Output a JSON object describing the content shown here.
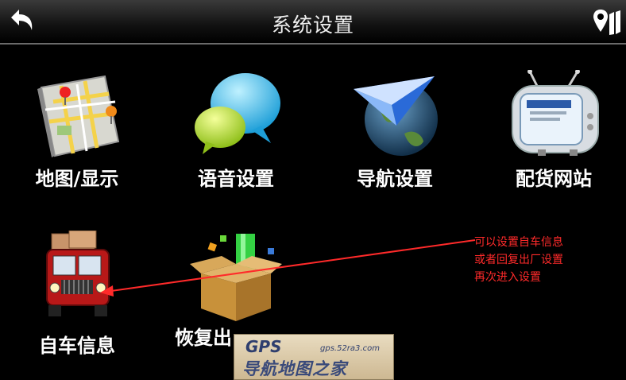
{
  "header": {
    "title": "系统设置",
    "back_icon": "back-arrow-icon",
    "map_icon": "map-pin-icon"
  },
  "menu": {
    "items": [
      {
        "label": "地图/显示",
        "icon": "map-icon"
      },
      {
        "label": "语音设置",
        "icon": "speech-bubble-icon"
      },
      {
        "label": "导航设置",
        "icon": "globe-navigation-icon"
      },
      {
        "label": "配货网站",
        "icon": "tv-website-icon"
      },
      {
        "label": "自车信息",
        "icon": "truck-icon"
      },
      {
        "label": "恢复出",
        "icon": "box-restore-icon"
      }
    ]
  },
  "annotation": {
    "lines": [
      "可以设置自车信息",
      "或者回复出厂设置",
      "再次进入设置"
    ],
    "color": "#ff2a2a"
  },
  "watermark": {
    "brand": "GPS",
    "site": "gps.52ra3.com",
    "name": "导航地图之家"
  },
  "colors": {
    "background": "#000000",
    "accent_red": "#ff2a2a"
  }
}
